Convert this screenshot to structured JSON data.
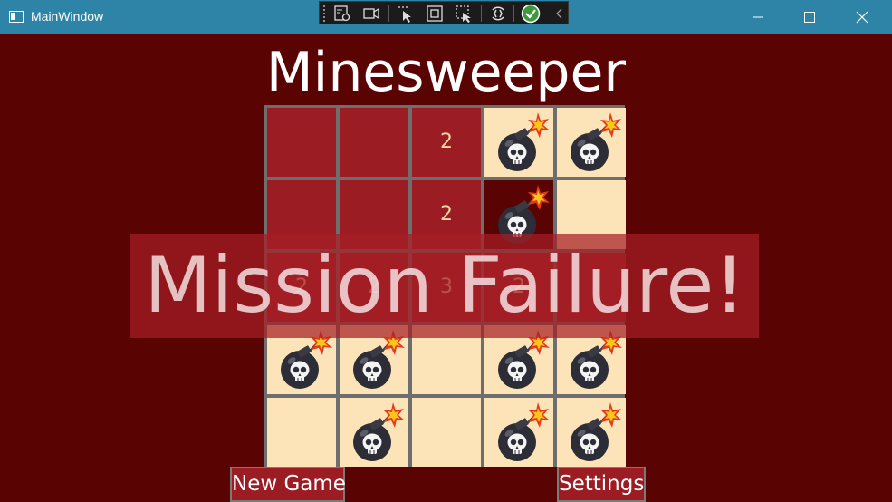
{
  "window": {
    "title": "MainWindow"
  },
  "debug_toolbar": {
    "icons": [
      "live-visual-tree-icon",
      "record-icon",
      "select-element-icon",
      "display-adorners-icon",
      "track-focus-icon",
      "hot-reload-icon",
      "binding-ok-icon",
      "collapse-chevron-icon"
    ]
  },
  "window_controls": [
    "minimize",
    "maximize",
    "close"
  ],
  "game": {
    "title": "Minesweeper",
    "rows": 5,
    "cols": 5,
    "cells": [
      [
        {
          "state": "hidden",
          "value": ""
        },
        {
          "state": "hidden",
          "value": ""
        },
        {
          "state": "hidden",
          "value": "2"
        },
        {
          "state": "mine",
          "value": ""
        },
        {
          "state": "mine",
          "value": ""
        }
      ],
      [
        {
          "state": "hidden",
          "value": ""
        },
        {
          "state": "hidden",
          "value": ""
        },
        {
          "state": "hidden",
          "value": "2"
        },
        {
          "state": "exploded",
          "value": ""
        },
        {
          "state": "revealed",
          "value": ""
        }
      ],
      [
        {
          "state": "hidden",
          "value": "2"
        },
        {
          "state": "hidden",
          "value": "2"
        },
        {
          "state": "hidden",
          "value": "3"
        },
        {
          "state": "hidden",
          "value": "2"
        },
        {
          "state": "hidden",
          "value": ""
        }
      ],
      [
        {
          "state": "mine",
          "value": ""
        },
        {
          "state": "mine",
          "value": ""
        },
        {
          "state": "revealed",
          "value": ""
        },
        {
          "state": "mine",
          "value": ""
        },
        {
          "state": "mine",
          "value": ""
        }
      ],
      [
        {
          "state": "revealed",
          "value": ""
        },
        {
          "state": "mine",
          "value": ""
        },
        {
          "state": "revealed",
          "value": ""
        },
        {
          "state": "mine",
          "value": ""
        },
        {
          "state": "mine",
          "value": ""
        }
      ]
    ],
    "overlay_message": "Mission Failure!"
  },
  "buttons": {
    "new_game": "New Game",
    "settings": "Settings"
  },
  "colors": {
    "background": "#5a0303",
    "titlebar": "#2e84a7",
    "hidden_cell": "#9b1c22",
    "revealed_cell": "#fde4b8",
    "cell_number": "#f2d8a4",
    "grid_line": "#6e6e6e"
  }
}
